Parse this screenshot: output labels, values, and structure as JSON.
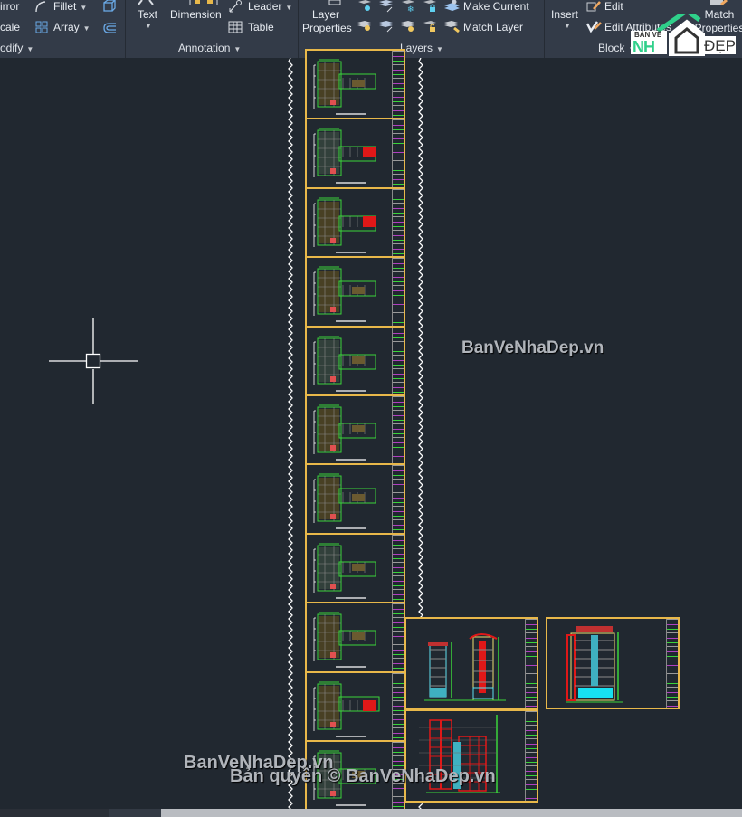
{
  "ribbon": {
    "modify": {
      "title": "odify",
      "items": [
        {
          "label": "irror",
          "icon": "mirror-icon"
        },
        {
          "label": "Fillet",
          "icon": "fillet-icon",
          "dropdown": true
        },
        {
          "label": "cale",
          "icon": "scale-icon"
        },
        {
          "label": "Array",
          "icon": "array-icon",
          "dropdown": true
        }
      ]
    },
    "annotation": {
      "title": "Annotation",
      "text_label": "Text",
      "dimension_label": "Dimension",
      "leader_label": "Leader",
      "table_label": "Table"
    },
    "layers": {
      "title": "Layers",
      "layer_properties_line1": "Layer",
      "layer_properties_line2": "Properties",
      "make_current_label": "Make Current",
      "match_layer_label": "Match Layer"
    },
    "block": {
      "title": "Block",
      "insert_label": "Insert",
      "edit_label": "Edit",
      "edit_attributes_label": "Edit Attributes"
    },
    "properties": {
      "match_line1": "Match",
      "match_line2": "Properties"
    }
  },
  "logo": {
    "line1": "BẢN VẼ",
    "nh": "NH",
    "dep": "ĐẸP",
    "color_green": "#2fd08a"
  },
  "canvas": {
    "background": "#212830",
    "sheet_border_color": "#e8b84a",
    "left_column_sheet_count": 11,
    "right_sheets": [
      "elevation-front-side",
      "elevation-rear",
      "section"
    ]
  },
  "watermarks": {
    "center": "BanVeNhaDep.vn",
    "bottom_left": "BanVeNhaDep.vn",
    "copyright": "Bản quyền © BanVeNhaDep.vn"
  }
}
